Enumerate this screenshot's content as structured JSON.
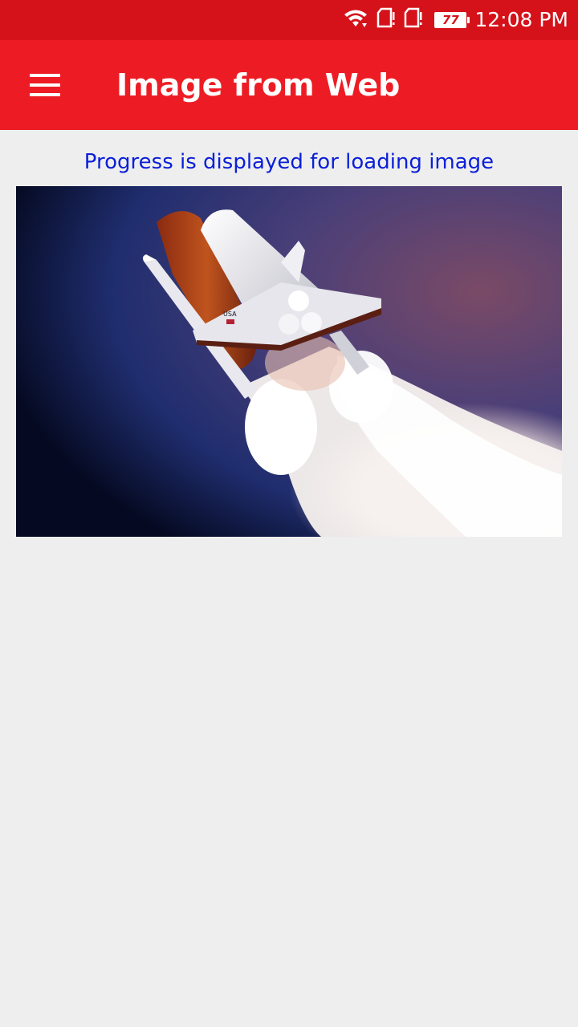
{
  "status_bar": {
    "icons": [
      "wifi-icon",
      "sim-card-icon",
      "sim-card-icon",
      "battery-icon"
    ],
    "battery_level": "77",
    "time": "12:08 PM"
  },
  "app_bar": {
    "menu_icon": "hamburger-menu-icon",
    "title": "Image from Web"
  },
  "content": {
    "caption": "Progress is displayed for loading image",
    "image_subject": "space-shuttle-launch-photo",
    "image_text": "USA"
  },
  "colors": {
    "status_bar": "#d5121a",
    "app_bar": "#ed1c24",
    "caption": "#0a1fd9",
    "background": "#eeeeee"
  }
}
